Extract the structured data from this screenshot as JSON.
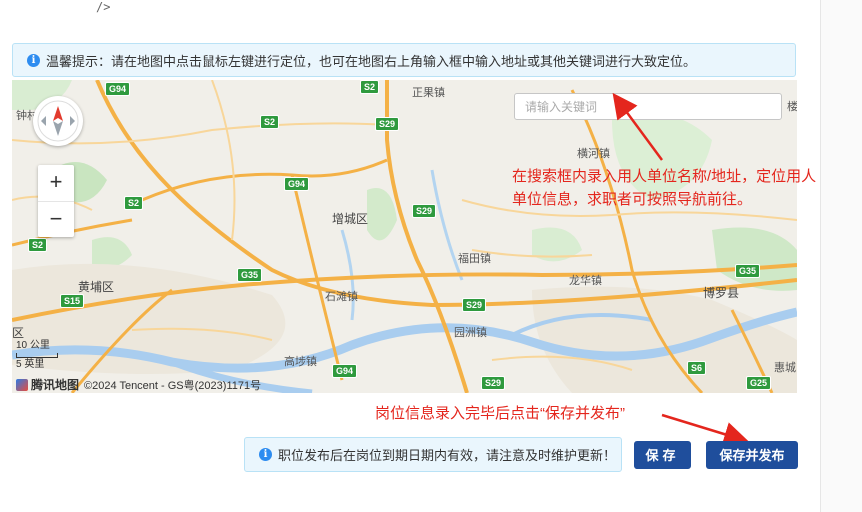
{
  "code_fragment": "/>",
  "tip": {
    "icon": "info-icon",
    "text": "温馨提示：请在地图中点击鼠标左键进行定位，也可在地图右上角输入框中输入地址或其他关键词进行大致定位。"
  },
  "map": {
    "search_placeholder": "请输入关键词",
    "zoom_in": "+",
    "zoom_out": "−",
    "scale_km": "10 公里",
    "scale_mi": "5 英里",
    "brand_name": "腾讯地图",
    "copyright": "©2024 Tencent - GS粤(2023)1171号",
    "places": {
      "zhengguo": "正果镇",
      "zhongcun": "钟村",
      "henghe": "横河镇",
      "zengcheng": "增城区",
      "futian": "福田镇",
      "huangpu": "黄埔区",
      "longhua": "龙华镇",
      "boluo": "博罗县",
      "shitan": "石滩镇",
      "yuanzhou": "园洲镇",
      "gaobu": "高埗镇",
      "qu": "区",
      "huicheng": "惠城",
      "lou": "楼"
    },
    "shields": {
      "g94_top": "G94",
      "s2_top": "S2",
      "s2_mid": "S2",
      "s29_top": "S29",
      "g94_mid": "G94",
      "s2_left": "S2",
      "s29_mid": "S29",
      "s2_far": "S2",
      "g35_left": "G35",
      "g35_right": "G35",
      "s15": "S15",
      "s29_low": "S29",
      "g94_low": "G94",
      "s29_bottom": "S29",
      "s6": "S6",
      "g25": "G25"
    }
  },
  "annotations": {
    "search_hint_line1": "在搜索框内录入用人单位名称/地址，定位用人",
    "search_hint_line2": "单位信息，求职者可按照导航前往。",
    "publish_hint": "岗位信息录入完毕后点击“保存并发布”"
  },
  "notice": {
    "icon": "info-icon",
    "text": "职位发布后在岗位到期日期内有效，请注意及时维护更新！"
  },
  "buttons": {
    "save": "保存",
    "publish": "保存并发布"
  },
  "colors": {
    "primary_button": "#1f4e9c",
    "annotation_red": "#e4261d",
    "info_blue": "#2d8cf0",
    "tip_background": "#eaf6fd"
  }
}
